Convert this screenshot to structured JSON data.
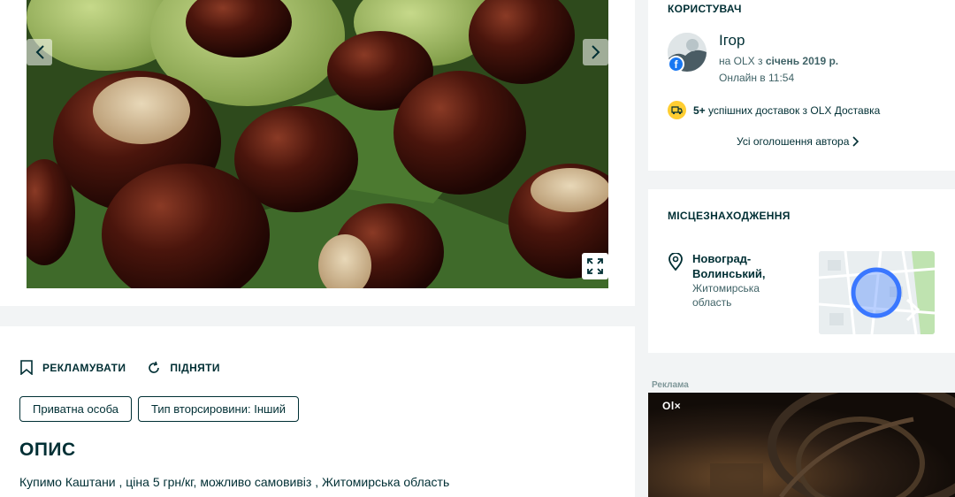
{
  "actions": {
    "promote": "РЕКЛАМУВАТИ",
    "raise": "ПІДНЯТИ"
  },
  "tags": [
    "Приватна особа",
    "Тип вторсировини: Інший"
  ],
  "description": {
    "title": "ОПИС",
    "text": "Купимо Каштани , ціна 5 грн/кг, можливо самовивіз , Житомирська область"
  },
  "user": {
    "section_title": "КОРИСТУВАЧ",
    "name": "Ігор",
    "since_prefix": "на OLX з ",
    "since_date": "січень 2019 р.",
    "online": "Онлайн в 11:54",
    "deliveries_count": "5+",
    "deliveries_text": " успішних доставок з OLX Доставка",
    "all_ads": "Усі оголошення автора"
  },
  "location": {
    "section_title": "МІСЦЕЗНАХОДЖЕННЯ",
    "city": "Новоград-Волинський,",
    "region": "Житомирська область"
  },
  "ad": {
    "label": "Реклама",
    "logo": "Ol×"
  },
  "colors": {
    "primary_text": "#002f34",
    "delivery_badge": "#ffce32",
    "map_marker": "#3a77ff"
  },
  "icons": [
    "chevron-left-icon",
    "chevron-right-icon",
    "expand-icon",
    "bookmark-icon",
    "refresh-icon",
    "truck-icon",
    "location-pin-icon",
    "facebook-icon"
  ]
}
